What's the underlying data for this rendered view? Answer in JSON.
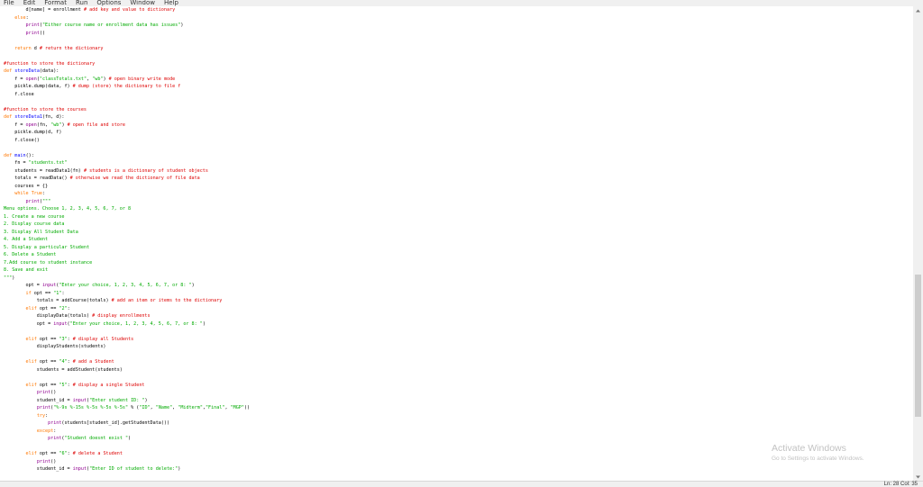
{
  "menu": [
    "File",
    "Edit",
    "Format",
    "Run",
    "Options",
    "Window",
    "Help"
  ],
  "status": {
    "position": "Ln: 28   Col: 35"
  },
  "watermark": {
    "title": "Activate Windows",
    "subtitle": "Go to Settings to activate Windows."
  },
  "code": [
    [
      [
        "        d[name] = enrollment ",
        ""
      ],
      [
        "# add key and value to dictionary",
        "cm"
      ]
    ],
    [
      [
        "    ",
        ""
      ],
      [
        "else",
        "kw"
      ],
      [
        ":",
        ""
      ]
    ],
    [
      [
        "        ",
        ""
      ],
      [
        "print",
        "bi"
      ],
      [
        "(",
        ""
      ],
      [
        "\"Either course name or enrollment data has issues\"",
        "st"
      ],
      [
        ")",
        ""
      ]
    ],
    [
      [
        "        ",
        ""
      ],
      [
        "print",
        "bi"
      ],
      [
        "()",
        ""
      ]
    ],
    [
      [
        "",
        ""
      ]
    ],
    [
      [
        "    ",
        ""
      ],
      [
        "return",
        "kw"
      ],
      [
        " d ",
        ""
      ],
      [
        "# return the dictionary",
        "cm"
      ]
    ],
    [
      [
        "",
        ""
      ]
    ],
    [
      [
        "#function to store the dictionary",
        "cm"
      ]
    ],
    [
      [
        "def",
        "kw"
      ],
      [
        " ",
        ""
      ],
      [
        "storeData",
        "df"
      ],
      [
        "(data):",
        ""
      ]
    ],
    [
      [
        "    f = ",
        ""
      ],
      [
        "open",
        "bi"
      ],
      [
        "(",
        ""
      ],
      [
        "\"classTotals.txt\"",
        "st"
      ],
      [
        ", ",
        ""
      ],
      [
        "\"wb\"",
        "st"
      ],
      [
        ") ",
        ""
      ],
      [
        "# open binary write mode",
        "cm"
      ]
    ],
    [
      [
        "    pickle.dump(data, f) ",
        ""
      ],
      [
        "# dump (store) the dictionary to file f",
        "cm"
      ]
    ],
    [
      [
        "    f.close",
        ""
      ]
    ],
    [
      [
        "",
        ""
      ]
    ],
    [
      [
        "#function to store the courses",
        "cm"
      ]
    ],
    [
      [
        "def",
        "kw"
      ],
      [
        " ",
        ""
      ],
      [
        "storeData1",
        "df"
      ],
      [
        "(fn, d):",
        ""
      ]
    ],
    [
      [
        "    f = ",
        ""
      ],
      [
        "open",
        "bi"
      ],
      [
        "(fn, ",
        ""
      ],
      [
        "\"wb\"",
        "st"
      ],
      [
        ") ",
        ""
      ],
      [
        "# open file and store",
        "cm"
      ]
    ],
    [
      [
        "    pickle.dump(d, f)",
        ""
      ]
    ],
    [
      [
        "    f.close()",
        ""
      ]
    ],
    [
      [
        "",
        ""
      ]
    ],
    [
      [
        "def",
        "kw"
      ],
      [
        " ",
        ""
      ],
      [
        "main",
        "df"
      ],
      [
        "():",
        ""
      ]
    ],
    [
      [
        "    fn = ",
        ""
      ],
      [
        "\"students.txt\"",
        "st"
      ]
    ],
    [
      [
        "    students = readData1(fn) ",
        ""
      ],
      [
        "# students is a dictionary of student objects",
        "cm"
      ]
    ],
    [
      [
        "    totals = readData() ",
        ""
      ],
      [
        "# otherwise we read the dictionary of file data",
        "cm"
      ]
    ],
    [
      [
        "    courses = {}",
        ""
      ]
    ],
    [
      [
        "    ",
        ""
      ],
      [
        "while",
        "kw"
      ],
      [
        " ",
        ""
      ],
      [
        "True",
        "kw"
      ],
      [
        ":",
        ""
      ]
    ],
    [
      [
        "        ",
        ""
      ],
      [
        "print",
        "bi"
      ],
      [
        "(",
        ""
      ],
      [
        "\"\"\"",
        "st"
      ]
    ],
    [
      [
        "Menu options. Choose 1, 2, 3, 4, 5, 6, 7, or 8",
        "st"
      ]
    ],
    [
      [
        "1. Create a new course",
        "st"
      ]
    ],
    [
      [
        "2. Display course data",
        "st"
      ]
    ],
    [
      [
        "3. Display All Student Data",
        "st"
      ]
    ],
    [
      [
        "4. Add a Student",
        "st"
      ]
    ],
    [
      [
        "5. Display a particular Student",
        "st"
      ]
    ],
    [
      [
        "6. Delete a Student",
        "st"
      ]
    ],
    [
      [
        "7.Add course to student instance",
        "st"
      ]
    ],
    [
      [
        "8. Save and exit",
        "st"
      ]
    ],
    [
      [
        "\"\"\"",
        "st"
      ],
      [
        ")",
        ""
      ]
    ],
    [
      [
        "        opt = ",
        ""
      ],
      [
        "input",
        "bi"
      ],
      [
        "(",
        ""
      ],
      [
        "\"Enter your choice, 1, 2, 3, 4, 5, 6, 7, or 8: \"",
        "st"
      ],
      [
        ")",
        ""
      ]
    ],
    [
      [
        "        ",
        ""
      ],
      [
        "if",
        "kw"
      ],
      [
        " opt == ",
        ""
      ],
      [
        "\"1\"",
        "st"
      ],
      [
        ":",
        ""
      ]
    ],
    [
      [
        "            totals = addCourse(totals) ",
        ""
      ],
      [
        "# add an item or items to the dictionary",
        "cm"
      ]
    ],
    [
      [
        "        ",
        ""
      ],
      [
        "elif",
        "kw"
      ],
      [
        " opt == ",
        ""
      ],
      [
        "\"2\"",
        "st"
      ],
      [
        ":",
        ""
      ]
    ],
    [
      [
        "            displayData(totals) ",
        ""
      ],
      [
        "# display enrollments",
        "cm"
      ]
    ],
    [
      [
        "            opt = ",
        ""
      ],
      [
        "input",
        "bi"
      ],
      [
        "(",
        ""
      ],
      [
        "\"Enter your choice, 1, 2, 3, 4, 5, 6, 7, or 8: \"",
        "st"
      ],
      [
        ")",
        ""
      ]
    ],
    [
      [
        "",
        ""
      ]
    ],
    [
      [
        "        ",
        ""
      ],
      [
        "elif",
        "kw"
      ],
      [
        " opt == ",
        ""
      ],
      [
        "\"3\"",
        "st"
      ],
      [
        ": ",
        ""
      ],
      [
        "# display all Students",
        "cm"
      ]
    ],
    [
      [
        "            displayStudents(students)",
        ""
      ]
    ],
    [
      [
        "",
        ""
      ]
    ],
    [
      [
        "        ",
        ""
      ],
      [
        "elif",
        "kw"
      ],
      [
        " opt == ",
        ""
      ],
      [
        "\"4\"",
        "st"
      ],
      [
        ": ",
        ""
      ],
      [
        "# add a Student",
        "cm"
      ]
    ],
    [
      [
        "            students = addStudent(students)",
        ""
      ]
    ],
    [
      [
        "",
        ""
      ]
    ],
    [
      [
        "        ",
        ""
      ],
      [
        "elif",
        "kw"
      ],
      [
        " opt == ",
        ""
      ],
      [
        "\"5\"",
        "st"
      ],
      [
        ": ",
        ""
      ],
      [
        "# display a single Student",
        "cm"
      ]
    ],
    [
      [
        "            ",
        ""
      ],
      [
        "print",
        "bi"
      ],
      [
        "()",
        ""
      ]
    ],
    [
      [
        "            student_id = ",
        ""
      ],
      [
        "input",
        "bi"
      ],
      [
        "(",
        ""
      ],
      [
        "\"Enter student ID: \"",
        "st"
      ],
      [
        ")",
        ""
      ]
    ],
    [
      [
        "            ",
        ""
      ],
      [
        "print",
        "bi"
      ],
      [
        "(",
        ""
      ],
      [
        "\"%-9s %-15s %-5s %-5s %-5s\"",
        "st"
      ],
      [
        " % (",
        ""
      ],
      [
        "\"ID\"",
        "st"
      ],
      [
        ", ",
        ""
      ],
      [
        "\"Name\"",
        "st"
      ],
      [
        ", ",
        ""
      ],
      [
        "\"Midterm\"",
        "st"
      ],
      [
        ",",
        ""
      ],
      [
        "\"Final\"",
        "st"
      ],
      [
        ", ",
        ""
      ],
      [
        "\"MGP\"",
        "st"
      ],
      [
        "))",
        ""
      ]
    ],
    [
      [
        "            ",
        ""
      ],
      [
        "try",
        "kw"
      ],
      [
        ":",
        ""
      ]
    ],
    [
      [
        "                ",
        ""
      ],
      [
        "print",
        "bi"
      ],
      [
        "(students[student_id].getStudentData())",
        ""
      ]
    ],
    [
      [
        "            ",
        ""
      ],
      [
        "except",
        "kw"
      ],
      [
        ":",
        ""
      ]
    ],
    [
      [
        "                ",
        ""
      ],
      [
        "print",
        "bi"
      ],
      [
        "(",
        ""
      ],
      [
        "\"Student doesnt exist \"",
        "st"
      ],
      [
        ")",
        ""
      ]
    ],
    [
      [
        "",
        ""
      ]
    ],
    [
      [
        "        ",
        ""
      ],
      [
        "elif",
        "kw"
      ],
      [
        " opt == ",
        ""
      ],
      [
        "\"6\"",
        "st"
      ],
      [
        ": ",
        ""
      ],
      [
        "# delete a Student",
        "cm"
      ]
    ],
    [
      [
        "            ",
        ""
      ],
      [
        "print",
        "bi"
      ],
      [
        "()",
        ""
      ]
    ],
    [
      [
        "            student_id = ",
        ""
      ],
      [
        "input",
        "bi"
      ],
      [
        "(",
        ""
      ],
      [
        "\"Enter ID of student to delete:\"",
        "st"
      ],
      [
        ")",
        ""
      ]
    ]
  ]
}
